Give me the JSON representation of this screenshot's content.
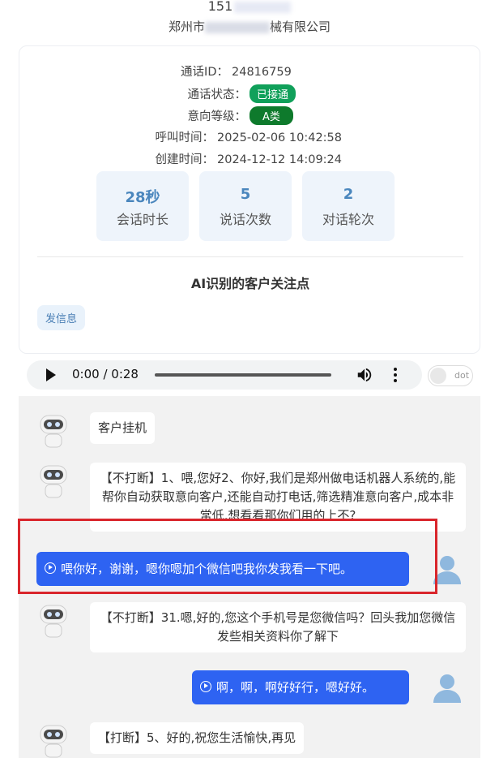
{
  "header": {
    "phone_prefix": "151",
    "company_prefix": "郑州市",
    "company_suffix": "械有限公司"
  },
  "call_info": [
    {
      "key": "通话ID：",
      "value": "24816759"
    },
    {
      "key": "通话状态：",
      "badge": "已接通",
      "badge_color": "#10a05a"
    },
    {
      "key": "意向等级：",
      "badge": "A类",
      "badge_color": "#0e7a2c"
    },
    {
      "key": "呼叫时间：",
      "value": "2025-02-06 10:42:58"
    },
    {
      "key": "创建时间：",
      "value": "2024-12-12 14:09:24"
    }
  ],
  "stats": [
    {
      "value": "28秒",
      "label": "会话时长"
    },
    {
      "value": "5",
      "label": "说话次数"
    },
    {
      "value": "2",
      "label": "对话轮次"
    }
  ],
  "ai_section": {
    "title": "AI识别的客户关注点",
    "send_button": "发信息"
  },
  "audio": {
    "time": "0:00 / 0:28",
    "toggle_text": "dot"
  },
  "messages": [
    {
      "from": "bot",
      "text": "客户挂机"
    },
    {
      "from": "bot",
      "text": "【不打断】1、喂,您好2、你好,我们是郑州做电话机器人系统的,能帮你自动获取意向客户,还能自动打电话,筛选精准意向客户,成本非常低,想看看那你们用的上不?"
    },
    {
      "from": "user",
      "text": "喂你好，谢谢，嗯你嗯加个微信吧我你发我看一下吧。"
    },
    {
      "from": "bot",
      "text": "【不打断】31.嗯,好的,您这个手机号是您微信吗？回头我加您微信发些相关资料你了解下"
    },
    {
      "from": "user",
      "text": "啊，啊，啊好好行，嗯好好。"
    },
    {
      "from": "bot",
      "text": "【打断】5、好的,祝您生活愉快,再见"
    }
  ],
  "colors": {
    "accent_blue": "#2e63f2",
    "highlight_red": "#d9262c",
    "stat_text": "#4a86bd"
  }
}
